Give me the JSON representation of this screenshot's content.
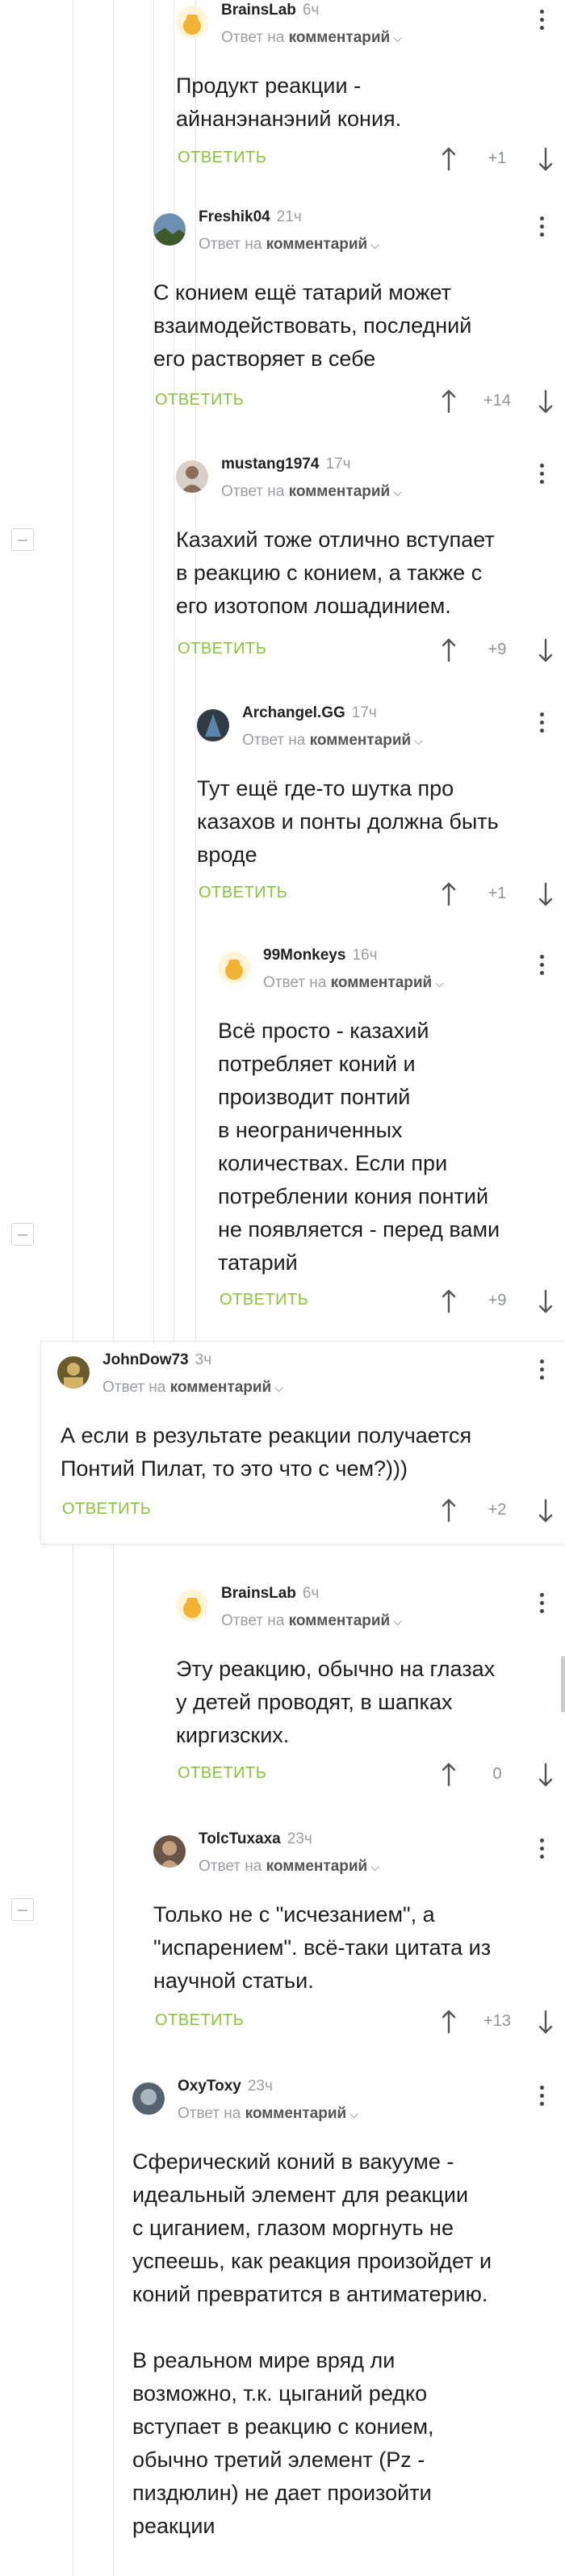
{
  "labels": {
    "reply_to_prefix": "Ответ на",
    "reply_to_target": "комментарий",
    "reply_action": "ОТВЕТИТЬ"
  },
  "comments": [
    {
      "user": "BrainsLab",
      "time": "6ч",
      "text": "Продукт реакции -\nайнанэнанэний кония.",
      "score": "+1"
    },
    {
      "user": "Freshik04",
      "time": "21ч",
      "text": "С конием ещё татарий может\nвзаимодействовать, последний\nего растворяет в себе",
      "score": "+14"
    },
    {
      "user": "mustang1974",
      "time": "17ч",
      "text": "Казахий тоже отлично вступает\nв реакцию с конием, а также с\nего изотопом лошадинием.",
      "score": "+9"
    },
    {
      "user": "Archangel.GG",
      "time": "17ч",
      "text": "Тут ещё где-то шутка про\nказахов и понты должна быть\nвроде",
      "score": "+1"
    },
    {
      "user": "99Monkeys",
      "time": "16ч",
      "text": "Всё просто - казахий\nпотребляет коний и\nпроизводит понтий\nв неограниченных\nколичествах. Если при\nпотреблении кония понтий\nне появляется - перед вами\nтатарий",
      "score": "+9"
    },
    {
      "user": "JohnDow73",
      "time": "3ч",
      "text": "А если в результате реакции получается\nПонтий Пилат, то это что с чем?)))",
      "score": "+2"
    },
    {
      "user": "BrainsLab",
      "time": "6ч",
      "text": "Эту реакцию, обычно на глазах\nу детей проводят, в шапках\nкиргизских.",
      "score": "0"
    },
    {
      "user": "TolcTuxaxa",
      "time": "23ч",
      "text": "Только не с \"исчезанием\", а\n\"испарением\". всё-таки цитата из\nнаучной статьи.",
      "score": "+13"
    },
    {
      "user": "OxyToxy",
      "time": "23ч",
      "text": "Сферический коний в вакууме -\nидеальный элемент для реакции\nс циганием, глазом моргнуть не\nуспеешь, как реакция произойдет и\nконий превратится в антиматерию.\n\nВ реальном мире вряд ли\nвозможно, т.к. цыганий редко\nвступает в реакцию с конием,\nобычно третий элемент (Pz -\nпиздюлин) не дает произойти\nреакции",
      "score": ""
    }
  ],
  "avatars": [
    {
      "icon": "brainslab-avatar-icon",
      "bg": "#fff4d6",
      "fg": "#f2b233"
    },
    {
      "icon": "landscape-avatar-icon",
      "bg": "#6d8fb0",
      "fg": "#3e5a2a"
    },
    {
      "icon": "person-avatar-icon",
      "bg": "#d8cfc6",
      "fg": "#8a6e5a"
    },
    {
      "icon": "dark-figure-avatar-icon",
      "bg": "#2f3a44",
      "fg": "#5b86a8"
    },
    {
      "icon": "brainslab-avatar-icon",
      "bg": "#fff4d6",
      "fg": "#f2b233"
    },
    {
      "icon": "soldier-avatar-icon",
      "bg": "#6b5a2e",
      "fg": "#d1b268"
    },
    {
      "icon": "brainslab-avatar-icon",
      "bg": "#fff4d6",
      "fg": "#f2b233"
    },
    {
      "icon": "bearded-man-avatar-icon",
      "bg": "#6a5446",
      "fg": "#c4a07f"
    },
    {
      "icon": "photo-avatar-icon",
      "bg": "#56636e",
      "fg": "#a9b6c0"
    }
  ],
  "colors": {
    "reply_green": "#8ac33b",
    "muted": "#9a9ea2",
    "thread_line": "#e4e6e8"
  }
}
